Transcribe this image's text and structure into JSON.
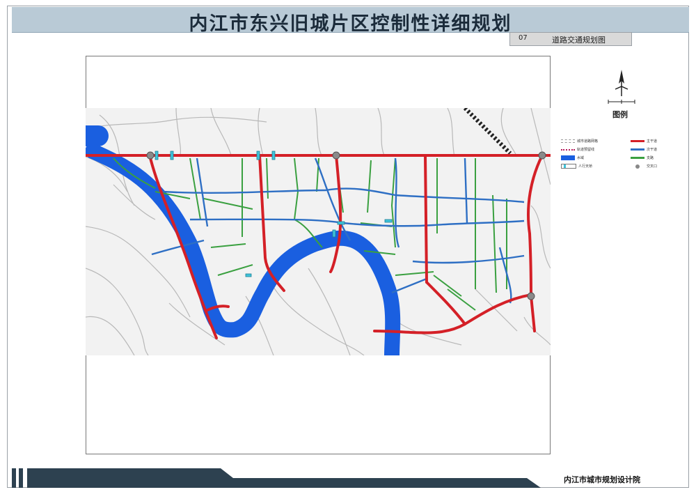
{
  "header": {
    "title": "内江市东兴旧城片区控制性详细规划"
  },
  "sheet": {
    "number": "07",
    "name": "道路交通规划图"
  },
  "legend": {
    "title": "图例",
    "items": [
      {
        "label": "城市道路网格",
        "icon": "dashed-grid-line",
        "color": "#9a9a9a"
      },
      {
        "label": "主干道",
        "icon": "solid-line",
        "color": "#d42027"
      },
      {
        "label": "轨道预留线",
        "icon": "dotted-line",
        "color": "#b5195a"
      },
      {
        "label": "次干道",
        "icon": "solid-line",
        "color": "#2e6fc4"
      },
      {
        "label": "水域",
        "icon": "fill-swatch",
        "color": "#1a5fe0"
      },
      {
        "label": "支路",
        "icon": "solid-line",
        "color": "#3aa040"
      },
      {
        "label": "人行天桥",
        "icon": "footbridge-swatch",
        "color": "#3fc3da"
      },
      {
        "label": "交叉口",
        "icon": "grey-dot",
        "color": "#888888"
      }
    ]
  },
  "footer": {
    "organization": "内江市城市规划设计院"
  },
  "colors": {
    "title_bar": "#b9cad6",
    "footer_dark": "#2d4150",
    "water": "#1a5fe0",
    "arterial": "#d42027",
    "secondary": "#2e6fc4",
    "branch": "#3aa040",
    "footbridge": "#3fc3da"
  }
}
